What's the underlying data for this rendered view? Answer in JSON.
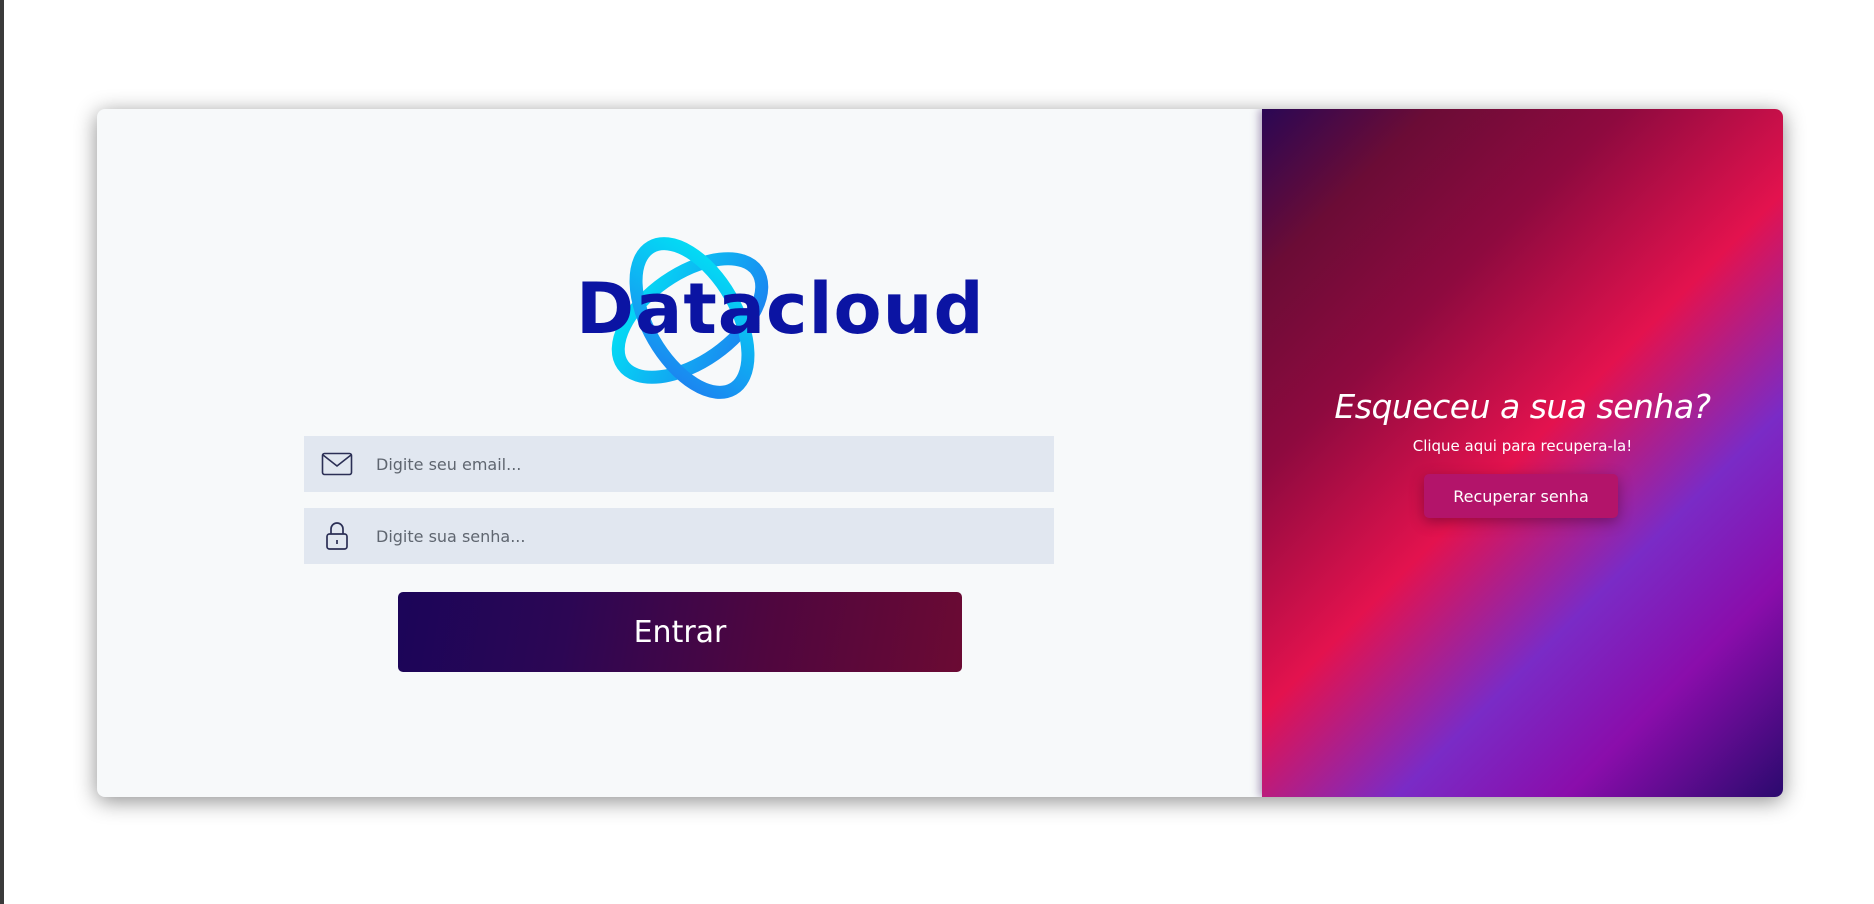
{
  "brand": {
    "name": "Datacloud",
    "colors": {
      "logo_text": "#0b14a3",
      "logo_ring_start": "#00e6f5",
      "logo_ring_end": "#1e7bf0"
    }
  },
  "login": {
    "email": {
      "icon": "envelope-icon",
      "placeholder": "Digite seu email...",
      "value": ""
    },
    "password": {
      "icon": "lock-icon",
      "placeholder": "Digite sua senha...",
      "value": ""
    },
    "submit_label": "Entrar"
  },
  "recovery": {
    "title": "Esqueceu a sua senha?",
    "subtitle": "Clique aqui para recupera-la!",
    "button_label": "Recuperar senha",
    "colors": {
      "button": "#b3146a",
      "gradient_stops": [
        "#2a0754",
        "#8e0a3f",
        "#e3124e",
        "#7a2bc6",
        "#2b0a6e"
      ]
    }
  }
}
